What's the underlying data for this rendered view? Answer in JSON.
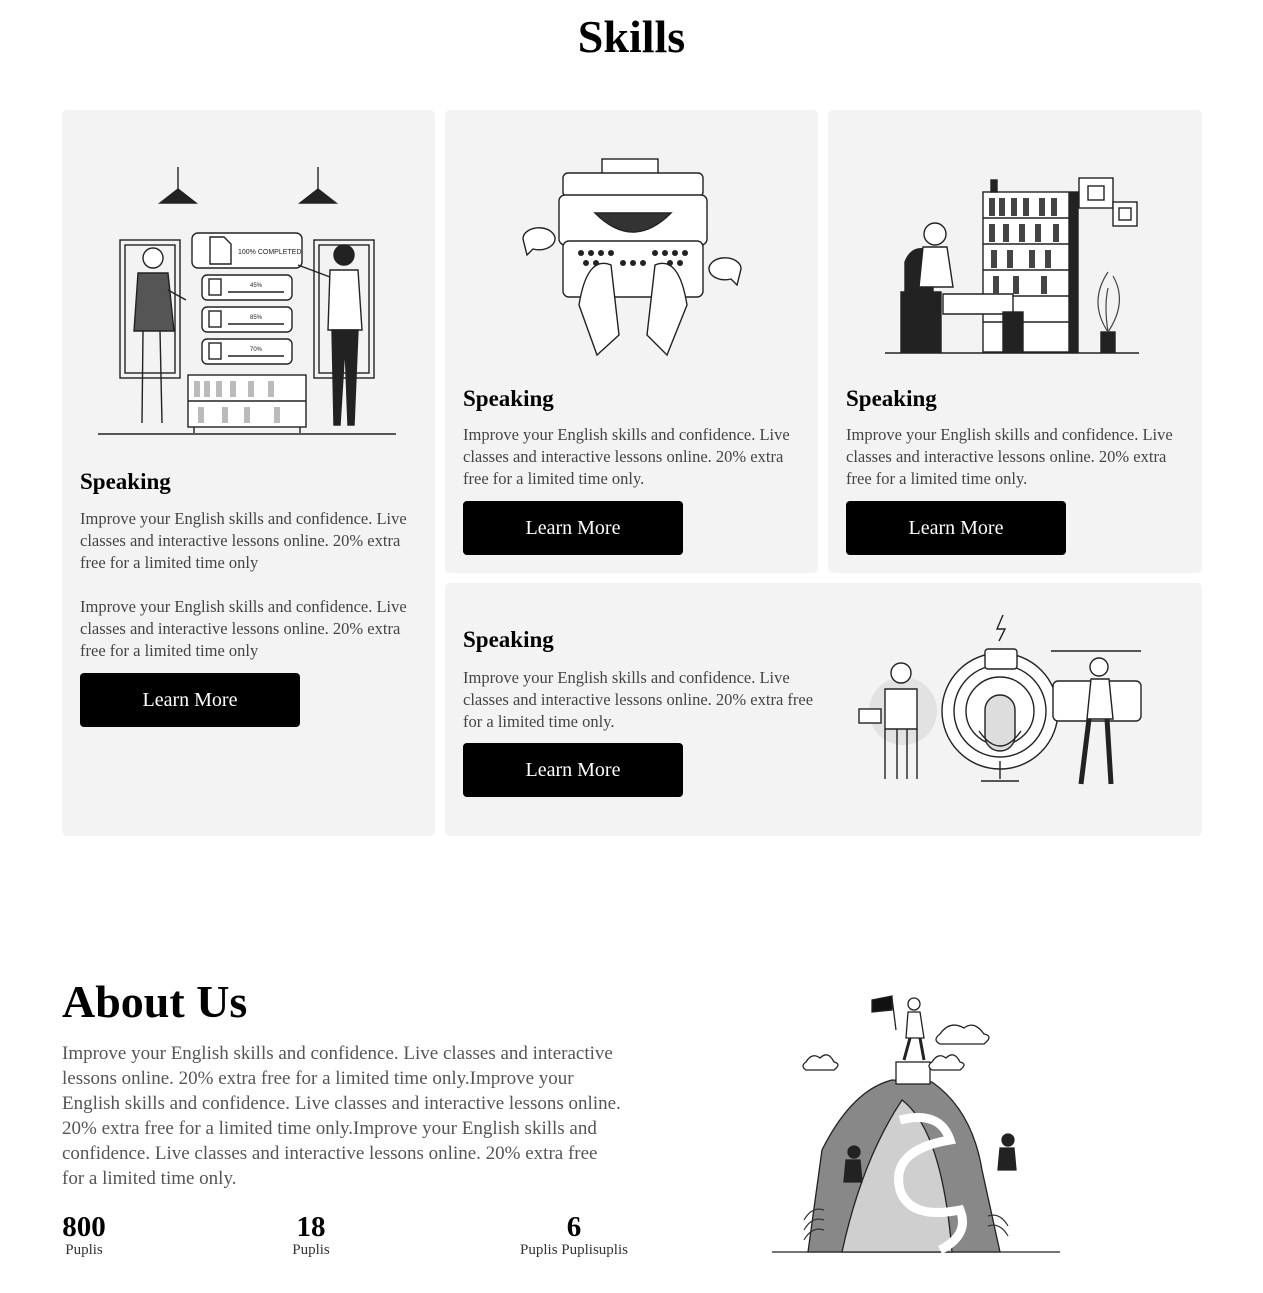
{
  "skills": {
    "title": "Skills",
    "cards": [
      {
        "title": "Speaking",
        "paragraphs": [
          "Improve your English skills and confidence. Live classes and interactive lessons online. 20% extra free for a limited time only",
          "Improve your English skills and confidence. Live classes and interactive lessons online. 20% extra free for a limited time only"
        ],
        "button": "Learn More",
        "illustration": {
          "completed_label": "100% COMPLETED",
          "progress": [
            "45%",
            "85%",
            "70%"
          ]
        }
      },
      {
        "title": "Speaking",
        "text": "Improve your English skills and confidence. Live classes and interactive lessons online. 20% extra free for a limited time only.",
        "button": "Learn More",
        "illustration": "typewriter"
      },
      {
        "title": "Speaking",
        "text": "Improve your English skills and confidence. Live classes and interactive lessons online. 20% extra free for a limited time only.",
        "button": "Learn More",
        "illustration": "reading-man"
      },
      {
        "title": "Speaking",
        "text": "Improve your English skills and confidence. Live classes and interactive lessons online. 20% extra free for a limited time only.",
        "button": "Learn More",
        "illustration": "podcast"
      }
    ]
  },
  "about": {
    "title": "About Us",
    "text": "Improve your English skills and confidence. Live classes and interactive lessons online. 20% extra free for a limited time only.Improve your English skills and confidence. Live classes and interactive lessons online. 20% extra free for a limited time only.Improve your English skills and confidence. Live classes and interactive lessons online. 20% extra free for a limited time only.",
    "stats": [
      {
        "value": "800",
        "label": "Puplis"
      },
      {
        "value": "18",
        "label": "Puplis"
      },
      {
        "value": "6",
        "label": "Puplis Puplisuplis"
      }
    ],
    "illustration": "mountain-climb"
  },
  "colors": {
    "card_bg": "#f3f3f3",
    "button_bg": "#000000",
    "button_text": "#ffffff"
  }
}
